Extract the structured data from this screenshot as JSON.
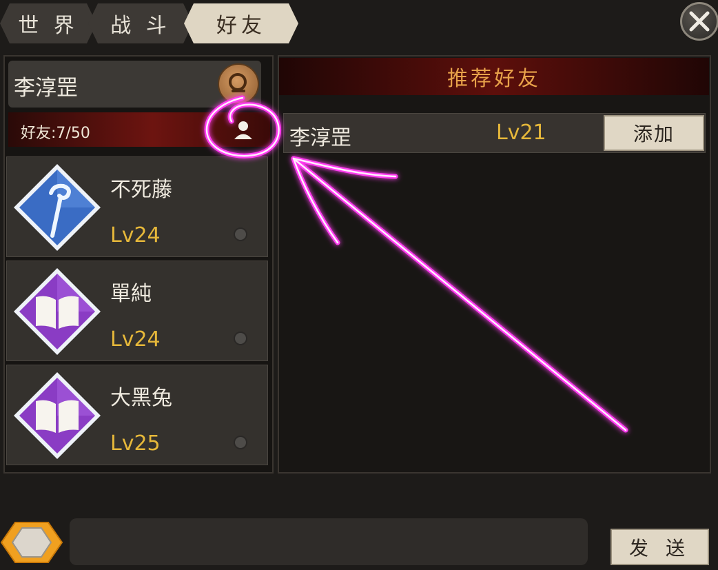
{
  "tabs": [
    {
      "label": "世 界",
      "active": false
    },
    {
      "label": "战 斗",
      "active": false
    },
    {
      "label": "好友",
      "active": true
    }
  ],
  "close_icon": "close-x-icon",
  "self": {
    "name": "李淳罡",
    "search_icon": "search-icon"
  },
  "friend_count": {
    "text": "好友:7/50",
    "icon": "person-icon"
  },
  "friends": [
    {
      "name": "不死藤",
      "level": "Lv24",
      "icon": "blue-staff-class-icon",
      "status": "offline"
    },
    {
      "name": "單純",
      "level": "Lv24",
      "icon": "purple-book-class-icon",
      "status": "offline"
    },
    {
      "name": "大黑兔",
      "level": "Lv25",
      "icon": "purple-book-class-icon",
      "status": "offline"
    }
  ],
  "recommend": {
    "header": "推荐好友",
    "items": [
      {
        "name": "李淳罡",
        "level": "Lv21",
        "button": "添加"
      }
    ]
  },
  "chat": {
    "toggle_icon": "hexagon-toggle-icon",
    "input_value": "",
    "send_label": "发 送"
  },
  "colors": {
    "level_gold": "#e6b83a",
    "header_text": "#e8a24a",
    "annotation_magenta": "#ff3df0",
    "tab_active": "#dfd6c3",
    "button_bg": "#e0d7c5"
  }
}
